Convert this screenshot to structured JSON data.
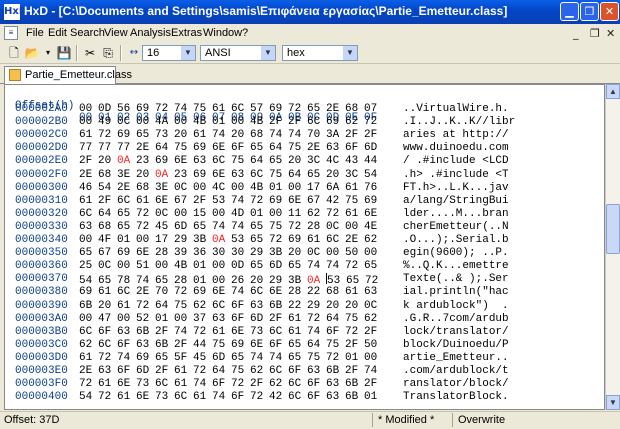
{
  "window": {
    "title": "HxD - [C:\\Documents and Settings\\samis\\Επιφάνεια εργασίας\\Partie_Emetteur.class]",
    "app_icon_text": "HxD"
  },
  "menu": [
    "File",
    "Edit",
    "Search",
    "View",
    "Analysis",
    "Extras",
    "Window",
    "?"
  ],
  "toolbar": {
    "bytes_per_row": "16",
    "charset": "ANSI",
    "offset_base": "hex"
  },
  "tab": {
    "label": "Partie_Emetteur.class"
  },
  "editor": {
    "header_offset": "Offset(h)",
    "header_columns": [
      "00",
      "01",
      "02",
      "03",
      "04",
      "05",
      "06",
      "07",
      "08",
      "09",
      "0A",
      "0B",
      "0C",
      "0D",
      "0E",
      "0F"
    ],
    "rows": [
      {
        "offset": "000002A0",
        "bytes": [
          "00",
          "0D",
          "56",
          "69",
          "72",
          "74",
          "75",
          "61",
          "6C",
          "57",
          "69",
          "72",
          "65",
          "2E",
          "68",
          "07"
        ],
        "text": "..VirtualWire.h."
      },
      {
        "offset": "000002B0",
        "bytes": [
          "00",
          "49",
          "0C",
          "00",
          "4A",
          "00",
          "4B",
          "01",
          "00",
          "4B",
          "2F",
          "2F",
          "6C",
          "69",
          "62",
          "72"
        ],
        "text": ".I..J..K..K//libr"
      },
      {
        "offset": "000002C0",
        "bytes": [
          "61",
          "72",
          "69",
          "65",
          "73",
          "20",
          "61",
          "74",
          "20",
          "68",
          "74",
          "74",
          "70",
          "3A",
          "2F",
          "2F"
        ],
        "text": "aries at http://"
      },
      {
        "offset": "000002D0",
        "bytes": [
          "77",
          "77",
          "77",
          "2E",
          "64",
          "75",
          "69",
          "6E",
          "6F",
          "65",
          "64",
          "75",
          "2E",
          "63",
          "6F",
          "6D"
        ],
        "text": "www.duinoedu.com"
      },
      {
        "offset": "000002E0",
        "bytes": [
          "2F",
          "20",
          "0A",
          "23",
          "69",
          "6E",
          "63",
          "6C",
          "75",
          "64",
          "65",
          "20",
          "3C",
          "4C",
          "43",
          "44"
        ],
        "text": "/ .#include <LCD"
      },
      {
        "offset": "000002F0",
        "bytes": [
          "2E",
          "68",
          "3E",
          "20",
          "0A",
          "23",
          "69",
          "6E",
          "63",
          "6C",
          "75",
          "64",
          "65",
          "20",
          "3C",
          "54"
        ],
        "text": ".h> .#include <T"
      },
      {
        "offset": "00000300",
        "bytes": [
          "46",
          "54",
          "2E",
          "68",
          "3E",
          "0C",
          "00",
          "4C",
          "00",
          "4B",
          "01",
          "00",
          "17",
          "6A",
          "61",
          "76"
        ],
        "text": "FT.h>..L.K...jav"
      },
      {
        "offset": "00000310",
        "bytes": [
          "61",
          "2F",
          "6C",
          "61",
          "6E",
          "67",
          "2F",
          "53",
          "74",
          "72",
          "69",
          "6E",
          "67",
          "42",
          "75",
          "69"
        ],
        "text": "a/lang/StringBui"
      },
      {
        "offset": "00000320",
        "bytes": [
          "6C",
          "64",
          "65",
          "72",
          "0C",
          "00",
          "15",
          "00",
          "4D",
          "01",
          "00",
          "11",
          "62",
          "72",
          "61",
          "6E"
        ],
        "text": "lder....M...bran"
      },
      {
        "offset": "00000330",
        "bytes": [
          "63",
          "68",
          "65",
          "72",
          "45",
          "6D",
          "65",
          "74",
          "74",
          "65",
          "75",
          "72",
          "28",
          "0C",
          "00",
          "4E"
        ],
        "text": "cherEmetteur(..N"
      },
      {
        "offset": "00000340",
        "bytes": [
          "00",
          "4F",
          "01",
          "00",
          "17",
          "29",
          "3B",
          "0A",
          "53",
          "65",
          "72",
          "69",
          "61",
          "6C",
          "2E",
          "62"
        ],
        "text": ".O...);.Serial.b"
      },
      {
        "offset": "00000350",
        "bytes": [
          "65",
          "67",
          "69",
          "6E",
          "28",
          "39",
          "36",
          "30",
          "30",
          "29",
          "3B",
          "20",
          "0C",
          "00",
          "50",
          "00"
        ],
        "text": "egin(9600); ..P."
      },
      {
        "offset": "00000360",
        "bytes": [
          "25",
          "0C",
          "00",
          "51",
          "00",
          "4B",
          "01",
          "00",
          "0D",
          "65",
          "6D",
          "65",
          "74",
          "74",
          "72",
          "65"
        ],
        "text": "%..Q.K...emettre"
      },
      {
        "offset": "00000370",
        "bytes": [
          "54",
          "65",
          "78",
          "74",
          "65",
          "28",
          "01",
          "00",
          "26",
          "20",
          "29",
          "3B",
          "0A",
          "53",
          "65",
          "72"
        ],
        "text": "Texte(..& );.Ser"
      },
      {
        "offset": "00000380",
        "bytes": [
          "69",
          "61",
          "6C",
          "2E",
          "70",
          "72",
          "69",
          "6E",
          "74",
          "6C",
          "6E",
          "28",
          "22",
          "68",
          "61",
          "63"
        ],
        "text": "ial.println(\"hac"
      },
      {
        "offset": "00000390",
        "bytes": [
          "6B",
          "20",
          "61",
          "72",
          "64",
          "75",
          "62",
          "6C",
          "6F",
          "63",
          "6B",
          "22",
          "29",
          "20",
          "20",
          "0C"
        ],
        "text": "k ardublock\")  ."
      },
      {
        "offset": "000003A0",
        "bytes": [
          "00",
          "47",
          "00",
          "52",
          "01",
          "00",
          "37",
          "63",
          "6F",
          "6D",
          "2F",
          "61",
          "72",
          "64",
          "75",
          "62"
        ],
        "text": ".G.R..7com/ardub"
      },
      {
        "offset": "000003B0",
        "bytes": [
          "6C",
          "6F",
          "63",
          "6B",
          "2F",
          "74",
          "72",
          "61",
          "6E",
          "73",
          "6C",
          "61",
          "74",
          "6F",
          "72",
          "2F"
        ],
        "text": "lock/translator/"
      },
      {
        "offset": "000003C0",
        "bytes": [
          "62",
          "6C",
          "6F",
          "63",
          "6B",
          "2F",
          "44",
          "75",
          "69",
          "6E",
          "6F",
          "65",
          "64",
          "75",
          "2F",
          "50"
        ],
        "text": "block/Duinoedu/P"
      },
      {
        "offset": "000003D0",
        "bytes": [
          "61",
          "72",
          "74",
          "69",
          "65",
          "5F",
          "45",
          "6D",
          "65",
          "74",
          "74",
          "65",
          "75",
          "72",
          "01",
          "00"
        ],
        "text": "artie_Emetteur.."
      },
      {
        "offset": "000003E0",
        "bytes": [
          "2E",
          "63",
          "6F",
          "6D",
          "2F",
          "61",
          "72",
          "64",
          "75",
          "62",
          "6C",
          "6F",
          "63",
          "6B",
          "2F",
          "74"
        ],
        "text": ".com/ardublock/t"
      },
      {
        "offset": "000003F0",
        "bytes": [
          "72",
          "61",
          "6E",
          "73",
          "6C",
          "61",
          "74",
          "6F",
          "72",
          "2F",
          "62",
          "6C",
          "6F",
          "63",
          "6B",
          "2F"
        ],
        "text": "ranslator/block/"
      },
      {
        "offset": "00000400",
        "bytes": [
          "54",
          "72",
          "61",
          "6E",
          "73",
          "6C",
          "61",
          "74",
          "6F",
          "72",
          "42",
          "6C",
          "6F",
          "63",
          "6B",
          "01"
        ],
        "text": "TranslatorBlock."
      }
    ]
  },
  "status": {
    "offset": "Offset: 37D",
    "modified": "* Modified *",
    "mode": "Overwrite"
  },
  "colors": {
    "offset_blue": "#0b3f8a",
    "modified_red": "#ff2020",
    "titlebar": "#0347c9"
  }
}
